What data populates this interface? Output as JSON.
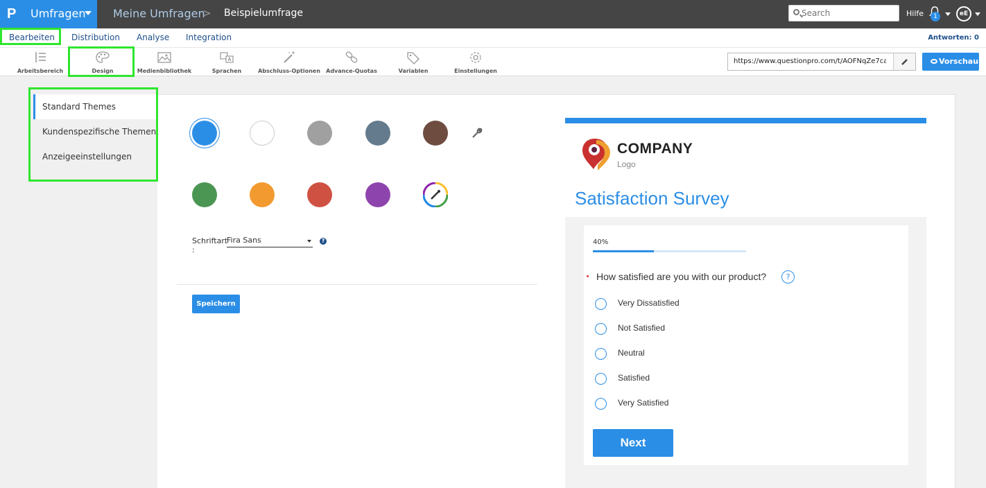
{
  "header": {
    "brand_logo": "P",
    "brand_label": "Umfragen",
    "breadcrumb_parent": "Meine Umfragen",
    "breadcrumb_separator": ">",
    "breadcrumb_current": "Beispielumfrage",
    "search_placeholder": "Search",
    "help_label": "Hilfe",
    "notification_count": "1",
    "avatar_initials": "eE"
  },
  "nav": {
    "tabs": [
      {
        "label": "Bearbeiten",
        "active": true
      },
      {
        "label": "Distribution",
        "active": false
      },
      {
        "label": "Analyse",
        "active": false
      },
      {
        "label": "Integration",
        "active": false
      }
    ],
    "answers": "Antworten: 0"
  },
  "toolbar": {
    "items": [
      {
        "label": "Arbeitsbereich",
        "icon": "workspace-icon"
      },
      {
        "label": "Design",
        "icon": "palette-icon"
      },
      {
        "label": "Medienbibliothek",
        "icon": "image-icon"
      },
      {
        "label": "Sprachen",
        "icon": "translate-icon"
      },
      {
        "label": "Abschluss-Optionen",
        "icon": "magic-wand-icon"
      },
      {
        "label": "Advance-Quotas",
        "icon": "link-icon"
      },
      {
        "label": "Variablen",
        "icon": "tag-icon"
      },
      {
        "label": "Einstellungen",
        "icon": "gear-icon"
      }
    ],
    "survey_url": "https://www.questionpro.com/t/AOFNqZe7ca",
    "preview_label": "Vorschau"
  },
  "design_menu": {
    "items": [
      {
        "label": "Standard Themes",
        "active": true
      },
      {
        "label": "Kundenspezifische Themen",
        "active": false
      },
      {
        "label": "Anzeigeeinstellungen",
        "active": false
      }
    ]
  },
  "theme_colors": {
    "row1": [
      "#2b8ee6",
      "#ffffff",
      "#a0a0a0",
      "#637b8c",
      "#6e4c3f"
    ],
    "row2": [
      "#4b9653",
      "#f29a30",
      "#cf5142",
      "#8e44ad"
    ],
    "selected": "#2b8ee6",
    "brand_blue": "#2b8ee6"
  },
  "font_settings": {
    "label": "Schriftart",
    "label_suffix": ":",
    "value": "Fira Sans",
    "help": "?"
  },
  "save_label": "Speichern",
  "preview": {
    "company_name": "COMPANY",
    "company_sub": "Logo",
    "survey_title": "Satisfaction Survey",
    "progress_text": "40%",
    "progress_value": 0.4,
    "question": "How satisfied are you with our product?",
    "question_help": "?",
    "options": [
      "Very Dissatisfied",
      "Not Satisfied",
      "Neutral",
      "Satisfied",
      "Very Satisfied"
    ],
    "next_label": "Next"
  }
}
